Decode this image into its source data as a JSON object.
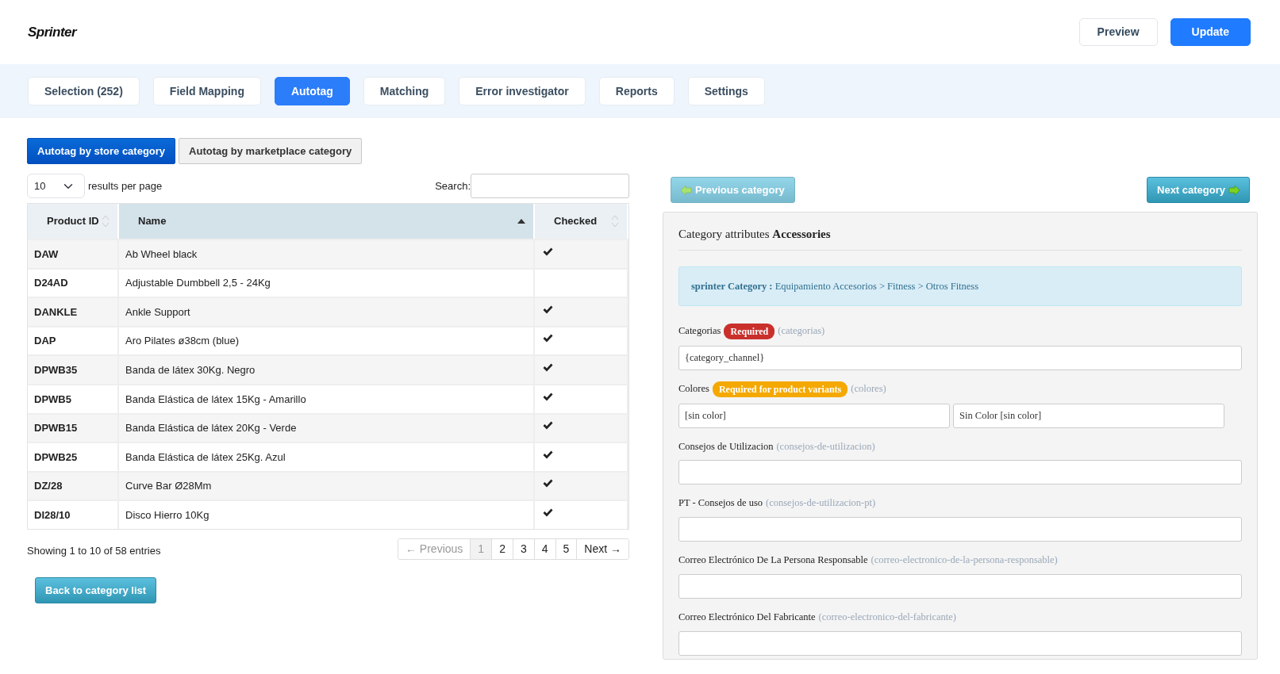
{
  "header": {
    "logo": "Sprinter",
    "buttons": [
      {
        "label": "Preview",
        "kind": "outline"
      },
      {
        "label": "Update",
        "kind": "primary"
      }
    ]
  },
  "tabs": [
    {
      "label": "Selection (252)",
      "selected": false
    },
    {
      "label": "Field Mapping",
      "selected": false
    },
    {
      "label": "Autotag",
      "selected": true
    },
    {
      "label": "Matching",
      "selected": false
    },
    {
      "label": "Error investigator",
      "selected": false
    },
    {
      "label": "Reports",
      "selected": false
    },
    {
      "label": "Settings",
      "selected": false
    }
  ],
  "subtabs": [
    {
      "label": "Autotag by store category",
      "selected": true
    },
    {
      "label": "Autotag by marketplace category",
      "selected": false
    }
  ],
  "table": {
    "page_size": "10",
    "page_size_label": "results per page",
    "search_label": "Search:",
    "columns": [
      {
        "label": "Product ID",
        "sorted": false
      },
      {
        "label": "Name",
        "sorted": true
      },
      {
        "label": "Checked",
        "sorted": false
      }
    ],
    "rows": [
      {
        "product_id": "DAW",
        "name": "Ab Wheel black",
        "checked": true
      },
      {
        "product_id": "D24AD",
        "name": "Adjustable Dumbbell 2,5 - 24Kg",
        "checked": false
      },
      {
        "product_id": "DANKLE",
        "name": "Ankle Support",
        "checked": true
      },
      {
        "product_id": "DAP",
        "name": "Aro Pilates ø38cm (blue)",
        "checked": true
      },
      {
        "product_id": "DPWB35",
        "name": "Banda de látex 30Kg. Negro",
        "checked": true
      },
      {
        "product_id": "DPWB5",
        "name": "Banda Elástica de látex 15Kg - Amarillo",
        "checked": true
      },
      {
        "product_id": "DPWB15",
        "name": "Banda Elástica de látex 20Kg - Verde",
        "checked": true
      },
      {
        "product_id": "DPWB25",
        "name": "Banda Elástica de látex 25Kg. Azul",
        "checked": true
      },
      {
        "product_id": "DZ/28",
        "name": "Curve Bar Ø28Mm",
        "checked": true
      },
      {
        "product_id": "DI28/10",
        "name": "Disco Hierro 10Kg",
        "checked": true
      }
    ],
    "info": "Showing 1 to 10 of 58 entries",
    "pagination": {
      "previous": {
        "label": "← Previous",
        "disabled": true
      },
      "pages": [
        {
          "label": "1",
          "selected": true
        },
        {
          "label": "2",
          "selected": false
        },
        {
          "label": "3",
          "selected": false
        },
        {
          "label": "4",
          "selected": false
        },
        {
          "label": "5",
          "selected": false
        }
      ],
      "next": {
        "label": "Next →",
        "disabled": false
      }
    }
  },
  "back_button": "Back to category list",
  "category_nav": {
    "previous": {
      "label": "Previous category",
      "disabled": true
    },
    "next": {
      "label": "Next category",
      "disabled": false
    }
  },
  "panel": {
    "title": "Category attributes **Accessories**",
    "alert": "**sprinter Category :** Equipamiento Accesorios > Fitness > Otros Fitness",
    "attributes": [
      {
        "label": "Categorias",
        "badge": {
          "text": "Required",
          "kind": "required"
        },
        "code": "(categorias)",
        "values": [
          "{category_channel}"
        ]
      },
      {
        "label": "Colores",
        "badge": {
          "text": "Required for product variants",
          "kind": "variants"
        },
        "code": "(colores)",
        "values": [
          "[sin color]",
          "Sin Color [sin color]"
        ]
      },
      {
        "label": "Consejos de Utilizacion",
        "code": "(consejos-de-utilizacion)"
      },
      {
        "label": "PT - Consejos de uso",
        "code": "(consejos-de-utilizacion-pt)"
      },
      {
        "label": "Correo Electrónico De La Persona Responsable",
        "code": "(correo-electronico-de-la-persona-responsable)"
      },
      {
        "label": "Correo Electrónico Del Fabricante",
        "code": "(correo-electronico-del-fabricante)"
      }
    ]
  }
}
